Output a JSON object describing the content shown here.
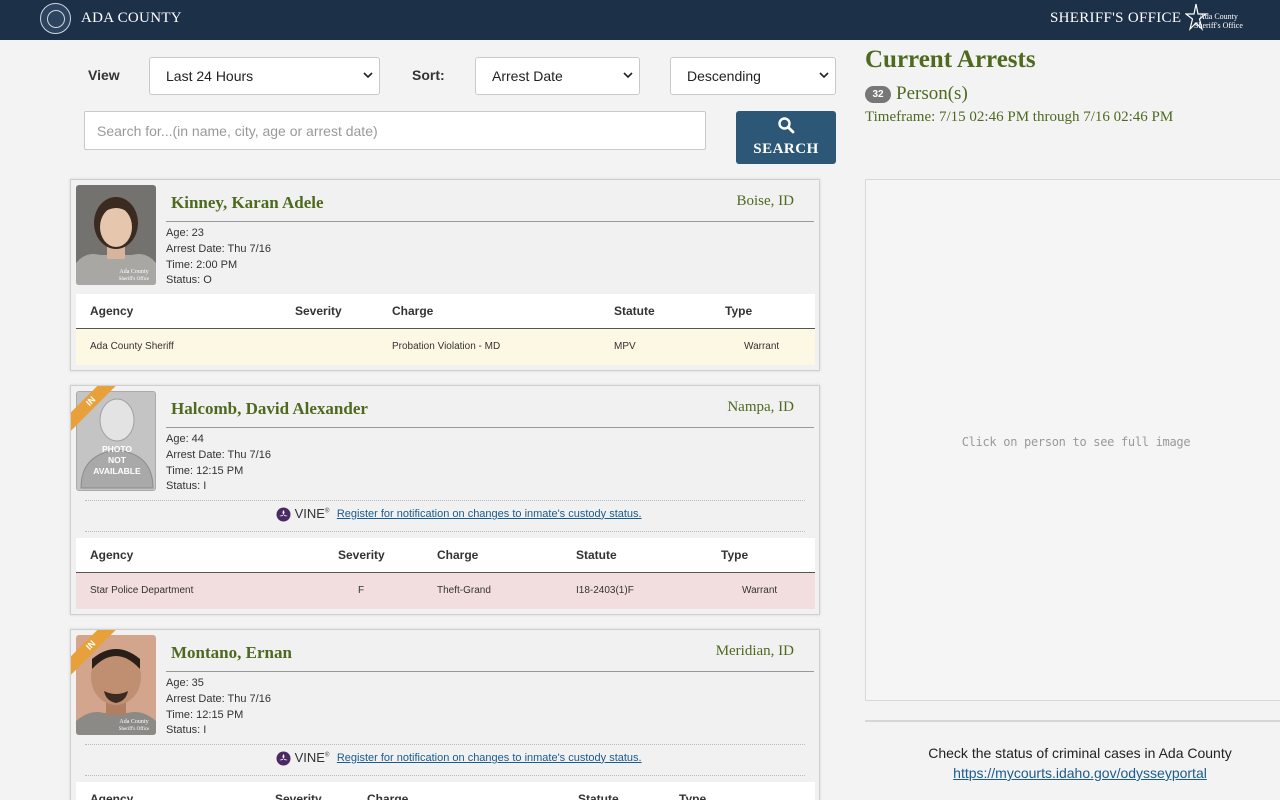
{
  "header": {
    "county": "ADA COUNTY",
    "office": "SHERIFF'S OFFICE",
    "logo_text_1": "Ada County",
    "logo_text_2": "Sheriff's Office"
  },
  "controls": {
    "view_label": "View",
    "view_value": "Last 24 Hours",
    "sort_label": "Sort:",
    "sort_value": "Arrest Date",
    "order_value": "Descending",
    "search_placeholder": "Search for...(in name, city, age or arrest date)",
    "search_button": "SEARCH"
  },
  "summary": {
    "title": "Current Arrests",
    "count": "32",
    "persons_label": "Person(s)",
    "timeframe": "Timeframe: 7/15 02:46 PM through 7/16 02:46 PM"
  },
  "viewer": {
    "hint": "Click on person to see full image"
  },
  "footer": {
    "courts_text": "Check the status of criminal cases in Ada County",
    "courts_link": "https://mycourts.idaho.gov/odysseyportal"
  },
  "table_headers": {
    "agency": "Agency",
    "severity": "Severity",
    "charge": "Charge",
    "statute": "Statute",
    "type": "Type"
  },
  "vine": {
    "logo": "VINE",
    "link": " Register for notification on changes to inmate's custody status."
  },
  "arrests": [
    {
      "name": "Kinney, Karan Adele",
      "city": "Boise, ID",
      "age": "Age: 23",
      "arrest_date": "Arrest Date: Thu 7/16",
      "time": "Time: 2:00 PM",
      "status": "Status: O",
      "ribbon": "",
      "charges": [
        {
          "agency": "Ada County Sheriff",
          "severity": "",
          "charge": "Probation Violation - MD",
          "statute": "MPV",
          "type": "Warrant"
        }
      ]
    },
    {
      "name": "Halcomb, David Alexander",
      "city": "Nampa, ID",
      "age": "Age: 44",
      "arrest_date": "Arrest Date: Thu 7/16",
      "time": "Time: 12:15 PM",
      "status": "Status: I",
      "ribbon": "IN",
      "photo_text": "PHOTO NOT AVAILABLE",
      "charges": [
        {
          "agency": "Star Police Department",
          "severity": "F",
          "charge": "Theft-Grand",
          "statute": "I18-2403(1)F",
          "type": "Warrant"
        }
      ]
    },
    {
      "name": "Montano, Ernan",
      "city": "Meridian, ID",
      "age": "Age: 35",
      "arrest_date": "Arrest Date: Thu 7/16",
      "time": "Time: 12:15 PM",
      "status": "Status: I",
      "ribbon": "IN"
    }
  ],
  "colors": {
    "header_bg": "#1c3048",
    "accent_green": "#4d6a1f",
    "search_button": "#2d5777",
    "misdemeanor_row": "#fcf8e3",
    "felony_row": "#f2dede",
    "ribbon": "#e8a13a"
  }
}
